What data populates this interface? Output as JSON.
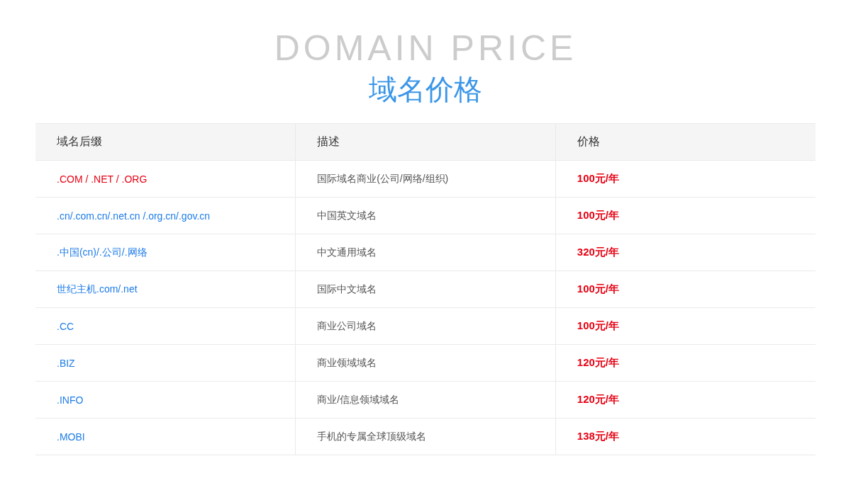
{
  "heading": {
    "english": "DOMAIN PRICE",
    "chinese": "域名价格"
  },
  "table": {
    "columns": [
      "域名后缀",
      "描述",
      "价格"
    ],
    "rows": [
      {
        "suffix": ".COM / .NET / .ORG",
        "color": "#e60012",
        "description": "国际域名商业(公司/网络/组织)",
        "price": "100元/年"
      },
      {
        "suffix": ".cn/.com.cn/.net.cn /.org.cn/.gov.cn",
        "color": "#1e7ce8",
        "description": "中国英文域名",
        "price": "100元/年"
      },
      {
        "suffix": ".中国(cn)/.公司/.网络",
        "color": "#1e7ce8",
        "description": "中文通用域名",
        "price": "320元/年"
      },
      {
        "suffix": "世纪主机.com/.net",
        "color": "#1e7ce8",
        "description": "国际中文域名",
        "price": "100元/年"
      },
      {
        "suffix": ".CC",
        "color": "#1e7ce8",
        "description": "商业公司域名",
        "price": "100元/年"
      },
      {
        "suffix": ".BIZ",
        "color": "#1e7ce8",
        "description": "商业领域域名",
        "price": "120元/年"
      },
      {
        "suffix": ".INFO",
        "color": "#1e7ce8",
        "description": "商业/信息领域域名",
        "price": "120元/年"
      },
      {
        "suffix": ".MOBI",
        "color": "#1e7ce8",
        "description": "手机的专属全球顶级域名",
        "price": "138元/年"
      }
    ]
  }
}
